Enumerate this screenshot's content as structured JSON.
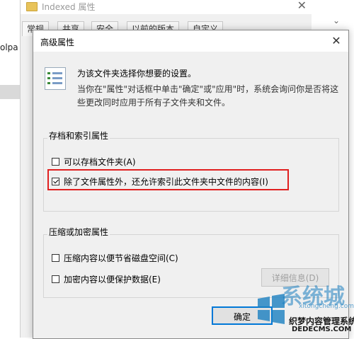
{
  "background_window": {
    "title": "Indexed 属性",
    "tabs": [
      "常规",
      "共享",
      "安全",
      "以前的版本",
      "自定义"
    ],
    "left_text": "olpa"
  },
  "dialog": {
    "title": "高级属性",
    "intro": {
      "line1": "为该文件夹选择你想要的设置。",
      "line2": "当你在\"属性\"对话框中单击\"确定\"或\"应用\"时，系统会询问你是否将这",
      "line3": "些更改同时应用于所有子文件夹和文件。"
    },
    "archive_group": {
      "label": "存档和索引属性",
      "archive_checkbox": {
        "label": "可以存档文件夹(A)",
        "checked": false
      },
      "index_checkbox": {
        "label": "除了文件属性外，还允许索引此文件夹中文件的内容(I)",
        "checked": true
      }
    },
    "compress_group": {
      "label": "压缩或加密属性",
      "compress_checkbox": {
        "label": "压缩内容以便节省磁盘空间(C)",
        "checked": false
      },
      "encrypt_checkbox": {
        "label": "加密内容以便保护数据(E)",
        "checked": false
      },
      "details_button": "详细信息(D)"
    },
    "ok_button": "确定"
  },
  "watermark": {
    "line1": "系统城",
    "line2": "织梦内容管理系统",
    "line3": "DEDECMS.COM",
    "small": "xitongcheng.com"
  },
  "colors": {
    "highlight": "#e02020",
    "dialog_bg": "#f0f0f0",
    "watermark_blue": "#1a7fc0"
  }
}
